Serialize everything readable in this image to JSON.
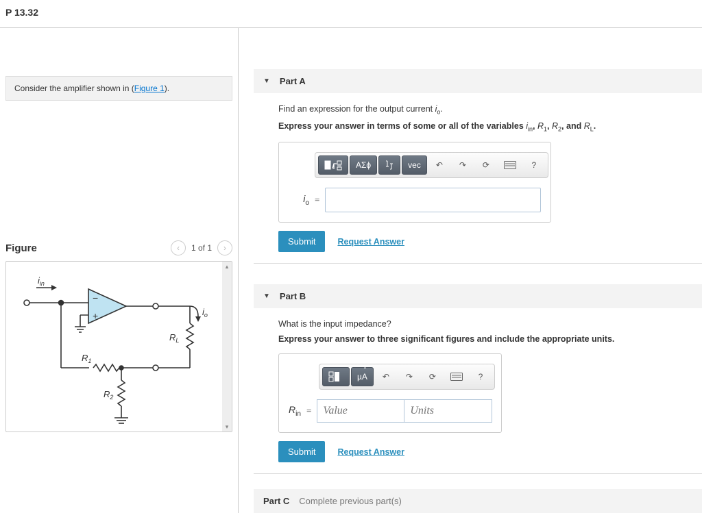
{
  "header": {
    "title": "P 13.32"
  },
  "left": {
    "prompt_prefix": "Consider the amplifier shown in (",
    "prompt_link": "Figure 1",
    "prompt_suffix": ").",
    "figure": {
      "title": "Figure",
      "counter": "1 of 1"
    }
  },
  "partA": {
    "label": "Part A",
    "question_prefix": "Find an expression for the output current ",
    "question_var": "i",
    "question_var_sub": "o",
    "question_suffix": ".",
    "instr_prefix": "Express your answer in terms of some or all of the variables ",
    "v1": "i",
    "v1s": "in",
    "v2": "R",
    "v2s": "1",
    "v3": "R",
    "v3s": "2",
    "and": ", and ",
    "v4": "R",
    "v4s": "L",
    "instr_suffix": ".",
    "lhs": "i",
    "lhs_sub": "o",
    "toolbar": {
      "templates": "▮√",
      "greek": "ΑΣϕ",
      "subsup": "↓↑",
      "vec": "vec",
      "undo": "↶",
      "redo": "↷",
      "reset": "⟳",
      "keyboard": "⌨",
      "help": "?"
    },
    "submit": "Submit",
    "request": "Request Answer"
  },
  "partB": {
    "label": "Part B",
    "question": "What is the input impedance?",
    "instr": "Express your answer to three significant figures and include the appropriate units.",
    "lhs": "R",
    "lhs_sub": "in",
    "value_ph": "Value",
    "units_ph": "Units",
    "toolbar": {
      "templates": "▮▮",
      "units": "µÅ",
      "undo": "↶",
      "redo": "↷",
      "reset": "⟳",
      "keyboard": "⌨",
      "help": "?"
    },
    "submit": "Submit",
    "request": "Request Answer"
  },
  "partC": {
    "label": "Part C",
    "sub": "Complete previous part(s)"
  }
}
